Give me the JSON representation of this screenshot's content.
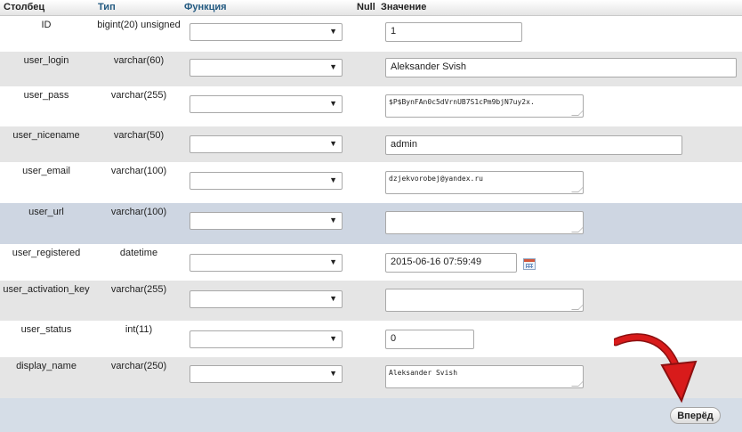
{
  "header": {
    "column": "Столбец",
    "type": "Тип",
    "function": "Функция",
    "null": "Null",
    "value": "Значение"
  },
  "rows": [
    {
      "name": "ID",
      "type": "bigint(20) unsigned",
      "value": "1"
    },
    {
      "name": "user_login",
      "type": "varchar(60)",
      "value": "Aleksander Svish"
    },
    {
      "name": "user_pass",
      "type": "varchar(255)",
      "value": "$P$BynFAn0c5dVrnUB7S1cPm9bjN7uy2x."
    },
    {
      "name": "user_nicename",
      "type": "varchar(50)",
      "value": "admin"
    },
    {
      "name": "user_email",
      "type": "varchar(100)",
      "value": "dzjekvorobej@yandex.ru"
    },
    {
      "name": "user_url",
      "type": "varchar(100)",
      "value": ""
    },
    {
      "name": "user_registered",
      "type": "datetime",
      "value": "2015-06-16 07:59:49"
    },
    {
      "name": "user_activation_key",
      "type": "varchar(255)",
      "value": ""
    },
    {
      "name": "user_status",
      "type": "int(11)",
      "value": "0"
    },
    {
      "name": "display_name",
      "type": "varchar(250)",
      "value": "Aleksander Svish"
    }
  ],
  "footer": {
    "forward_label": "Вперёд"
  },
  "icons": {
    "select_arrow": "dropdown-arrow-icon",
    "calendar": "calendar-icon",
    "annotation": "red-curved-arrow"
  },
  "colors": {
    "header_link": "#235a81",
    "row_alt": "#e5e5e5",
    "row_hover": "#ced6e2",
    "annotation_arrow": "#d81b1b"
  }
}
